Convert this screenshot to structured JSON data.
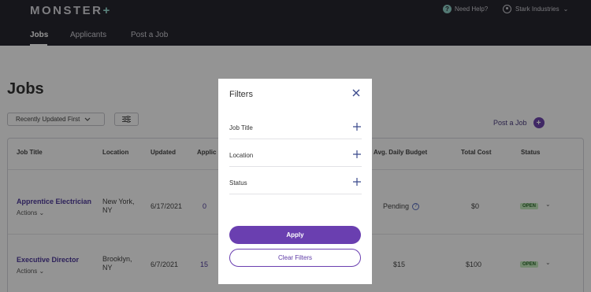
{
  "header": {
    "logo_main": "MONSTER",
    "logo_plus": "+",
    "help_label": "Need Help?",
    "account_name": "Stark Industries",
    "nav": [
      {
        "label": "Jobs",
        "active": true
      },
      {
        "label": "Applicants",
        "active": false
      },
      {
        "label": "Post a Job",
        "active": false
      }
    ]
  },
  "main": {
    "title": "Jobs",
    "sort_label": "Recently Updated First",
    "post_job_label": "Post a Job",
    "columns": [
      "Job Title",
      "Location",
      "Updated",
      "Applic",
      "Avg. Daily Budget",
      "Total Cost",
      "Status"
    ],
    "rows": [
      {
        "title": "Apprentice Electrician",
        "actions": "Actions",
        "location_l1": "New York,",
        "location_l2": "NY",
        "updated": "6/17/2021",
        "applicants": "0",
        "budget": "Pending",
        "total": "$0",
        "status": "OPEN"
      },
      {
        "title": "Executive Director",
        "actions": "Actions",
        "location_l1": "Brooklyn,",
        "location_l2": "NY",
        "updated": "6/7/2021",
        "applicants": "15",
        "budget": "$15",
        "total": "$100",
        "status": "OPEN"
      }
    ]
  },
  "modal": {
    "title": "Filters",
    "filters": [
      {
        "label": "Job Title"
      },
      {
        "label": "Location"
      },
      {
        "label": "Status"
      }
    ],
    "apply_label": "Apply",
    "clear_label": "Clear Filters"
  },
  "colors": {
    "header_bg": "#27262f",
    "accent": "#6a3fb0",
    "link": "#4e3a9c",
    "status_badge": "#c7ecc0",
    "overlay": "rgba(0,0,0,0.42)"
  },
  "icons": {
    "help": "question-circle-icon",
    "account": "user-icon",
    "close": "close-icon",
    "add": "plus-icon",
    "filter": "sliders-icon",
    "chevron": "chevron-down-icon"
  }
}
